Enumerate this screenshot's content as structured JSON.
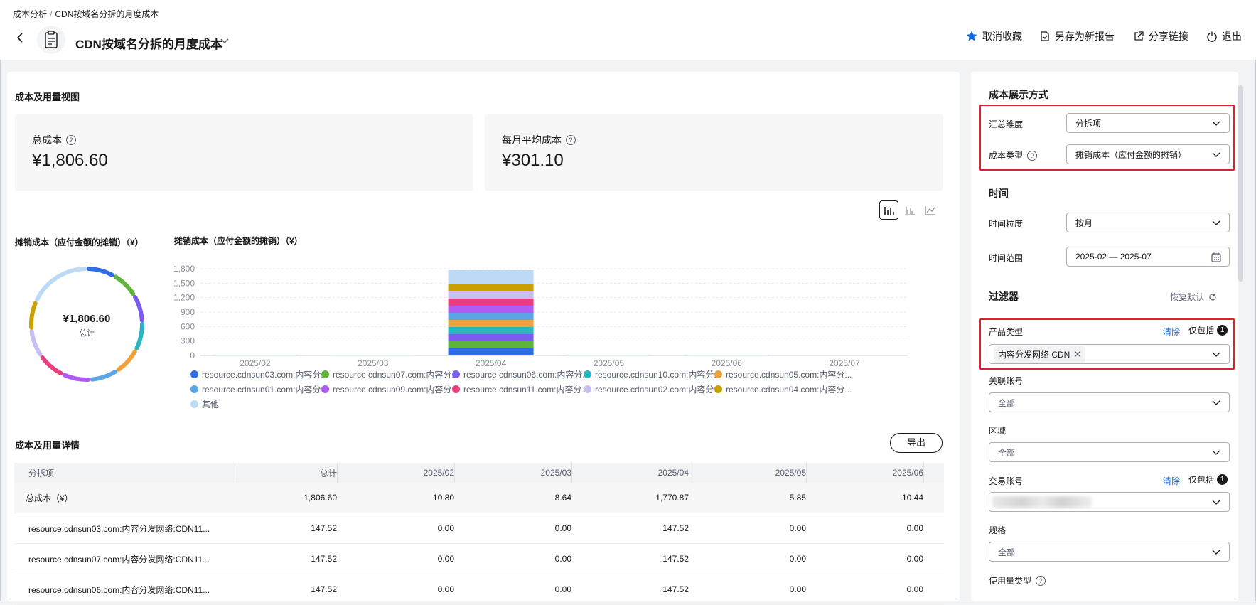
{
  "breadcrumb": {
    "root": "成本分析",
    "sep": "/",
    "current": "CDN按域名分拆的月度成本"
  },
  "header": {
    "title": "CDN按域名分拆的月度成本",
    "actions": {
      "unfavorite": "取消收藏",
      "save_as_new": "另存为新报告",
      "share_link": "分享链接",
      "exit": "退出"
    },
    "accent_color": "#0e6ae1"
  },
  "overview": {
    "section_title": "成本及用量视图",
    "total_cost_label": "总成本",
    "total_cost_value": "¥1,806.60",
    "avg_cost_label": "每月平均成本",
    "avg_cost_value": "¥301.10",
    "view_icons": [
      "stacked-bar-chart-icon",
      "grouped-bar-chart-icon",
      "line-chart-icon"
    ]
  },
  "donut": {
    "label": "摊销成本（应付金额的摊销）（¥）",
    "center_value": "¥1,806.60",
    "center_sub": "总计"
  },
  "chart_data": {
    "type": "bar",
    "title": "摊销成本（应付金额的摊销）（¥）",
    "stacked": true,
    "categories": [
      "2025/02",
      "2025/03",
      "2025/04",
      "2025/05",
      "2025/06",
      "2025/07"
    ],
    "yticks": [
      "0",
      "300",
      "600",
      "900",
      "1,200",
      "1,500",
      "1,800"
    ],
    "ylim": [
      0,
      1800
    ],
    "series": [
      {
        "name": "resource.cdnsun03.com:内容分...",
        "color": "#2d6ee8",
        "values": [
          0,
          0,
          147.52,
          0,
          0,
          0
        ]
      },
      {
        "name": "resource.cdnsun07.com:内容分...",
        "color": "#5fb43c",
        "values": [
          0,
          0,
          147.52,
          0,
          0,
          0
        ]
      },
      {
        "name": "resource.cdnsun06.com:内容分...",
        "color": "#7b5bf0",
        "values": [
          0,
          0,
          147.52,
          0,
          0,
          0
        ]
      },
      {
        "name": "resource.cdnsun10.com:内容分...",
        "color": "#27b6c2",
        "values": [
          0,
          0,
          147.52,
          0,
          0,
          0
        ]
      },
      {
        "name": "resource.cdnsun05.com:内容分...",
        "color": "#f0a13a",
        "values": [
          0,
          0,
          147.52,
          0,
          0,
          0
        ]
      },
      {
        "name": "resource.cdnsun01.com:内容分...",
        "color": "#5ba4e6",
        "values": [
          0,
          0,
          147.52,
          0,
          0,
          0
        ]
      },
      {
        "name": "resource.cdnsun09.com:内容分...",
        "color": "#b05cf0",
        "values": [
          0,
          0,
          147.52,
          0,
          0,
          0
        ]
      },
      {
        "name": "resource.cdnsun11.com:内容分...",
        "color": "#e8407f",
        "values": [
          0,
          0,
          147.52,
          0,
          0,
          0
        ]
      },
      {
        "name": "resource.cdnsun02.com:内容分...",
        "color": "#c5bff2",
        "values": [
          0,
          0,
          147.52,
          0,
          0,
          0
        ]
      },
      {
        "name": "resource.cdnsun04.com:内容分...",
        "color": "#c8a000",
        "values": [
          0,
          0,
          147.52,
          0,
          0,
          0
        ]
      },
      {
        "name": "其他",
        "color": "#bcd9f5",
        "values": [
          10.8,
          8.64,
          295.67,
          5.85,
          10.44,
          0
        ]
      }
    ]
  },
  "details": {
    "section_title": "成本及用量详情",
    "export_label": "导出",
    "columns": [
      "分拆项",
      "总计",
      "2025/02",
      "2025/03",
      "2025/04",
      "2025/05",
      "2025/06"
    ],
    "total_row": [
      "总成本（¥）",
      "1,806.60",
      "10.80",
      "8.64",
      "1,770.87",
      "5.85",
      "10.44"
    ],
    "rows": [
      [
        "resource.cdnsun03.com:内容分发网络:CDN11...",
        "147.52",
        "0.00",
        "0.00",
        "147.52",
        "0.00",
        "0.00"
      ],
      [
        "resource.cdnsun07.com:内容分发网络:CDN11...",
        "147.52",
        "0.00",
        "0.00",
        "147.52",
        "0.00",
        "0.00"
      ],
      [
        "resource.cdnsun06.com:内容分发网络:CDN11...",
        "147.52",
        "0.00",
        "0.00",
        "147.52",
        "0.00",
        "0.00"
      ]
    ]
  },
  "side": {
    "display_title": "成本展示方式",
    "agg_label": "汇总维度",
    "agg_value": "分拆项",
    "cost_type_label": "成本类型",
    "cost_type_value": "摊销成本（应付金额的摊销）",
    "time_title": "时间",
    "granularity_label": "时间粒度",
    "granularity_value": "按月",
    "range_label": "时间范围",
    "range_value": "2025-02 — 2025-07",
    "filter_title": "过滤器",
    "restore_label": "恢复默认",
    "product_label": "产品类型",
    "clear_label": "清除",
    "only_include_label": "仅包括",
    "product_badge": "1",
    "product_tag": "内容分发网络 CDN",
    "linked_account_label": "关联账号",
    "linked_account_value": "全部",
    "region_label": "区域",
    "region_value": "全部",
    "trade_account_label": "交易账号",
    "trade_badge": "1",
    "spec_label": "规格",
    "spec_value": "全部",
    "usage_type_label": "使用量类型",
    "highlight_color": "#e0202a"
  }
}
